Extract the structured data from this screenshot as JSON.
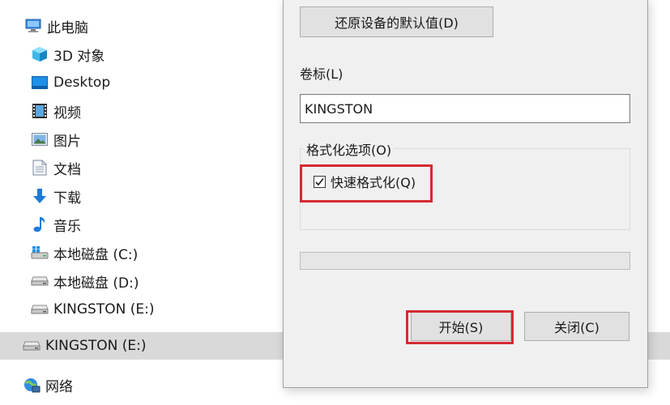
{
  "nav": {
    "items": [
      {
        "label": "此电脑",
        "icon": "this-pc-icon"
      },
      {
        "label": "3D 对象",
        "icon": "3d-objects-icon"
      },
      {
        "label": "Desktop",
        "icon": "desktop-icon"
      },
      {
        "label": "视频",
        "icon": "videos-icon"
      },
      {
        "label": "图片",
        "icon": "pictures-icon"
      },
      {
        "label": "文档",
        "icon": "documents-icon"
      },
      {
        "label": "下载",
        "icon": "downloads-icon"
      },
      {
        "label": "音乐",
        "icon": "music-icon"
      },
      {
        "label": "本地磁盘 (C:)",
        "icon": "windows-drive-icon"
      },
      {
        "label": "本地磁盘 (D:)",
        "icon": "drive-icon"
      },
      {
        "label": "KINGSTON (E:)",
        "icon": "usb-drive-icon"
      },
      {
        "label": "KINGSTON (E:)",
        "icon": "usb-drive-icon",
        "selected": true
      },
      {
        "label": "网络",
        "icon": "network-icon"
      }
    ]
  },
  "dialog": {
    "restore_defaults_label": "还原设备的默认值(D)",
    "volume_label_title": "卷标(L)",
    "volume_label_value": "KINGSTON",
    "format_options_title": "格式化选项(O)",
    "quick_format_label": "快速格式化(Q)",
    "quick_format_checked": true,
    "progress": 0,
    "start_label": "开始(S)",
    "close_label": "关闭(C)"
  },
  "colors": {
    "highlight": "#d42a32",
    "selected_row": "#d9d9d9",
    "dialog_bg": "#f0f0f0",
    "button_bg": "#e1e1e1"
  }
}
